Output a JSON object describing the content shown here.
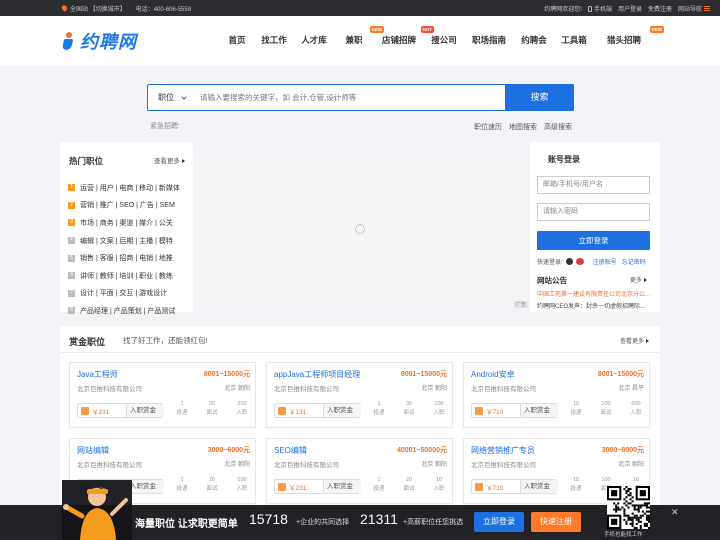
{
  "topbar": {
    "location": "全国站",
    "switch_city": "【切换城市】",
    "phone_label": "电话：400-606-5558",
    "welcome": "约聘网欢迎您!",
    "mobile": "手机端",
    "user_login": "用户登录",
    "free_register": "免费注册",
    "site_nav": "网站导航"
  },
  "logo": {
    "text": "约聘网"
  },
  "nav": [
    {
      "label": "首页",
      "badge": ""
    },
    {
      "label": "找工作",
      "badge": ""
    },
    {
      "label": "人才库",
      "badge": ""
    },
    {
      "label": "兼职",
      "badge": "NEW"
    },
    {
      "label": "店铺招牌",
      "badge": "HOT"
    },
    {
      "label": "搜公司",
      "badge": ""
    },
    {
      "label": "职场指南",
      "badge": ""
    },
    {
      "label": "约聘会",
      "badge": ""
    },
    {
      "label": "工具箱",
      "badge": ""
    },
    {
      "label": "猎头招聘",
      "badge": "NEW"
    }
  ],
  "search": {
    "type": "职位",
    "placeholder": "请输入要搜索的关键字，如 会计,仓管,设计师等",
    "button": "搜索"
  },
  "hot_search_label": "紧急招聘:",
  "search_links": [
    "职位速历",
    "地图搜索",
    "高级搜索"
  ],
  "hot_jobs": {
    "title": "热门职位",
    "more": "查看更多",
    "items": [
      "运营 | 用户 | 电商 | 移动 | 新媒体",
      "营销 | 推广 | SEO | 广告 | SEM",
      "市场 | 商务 | 渠道 | 媒介 | 公关",
      "编辑 | 文案 | 后期 | 主播 | 模特",
      "销售 | 客服 | 招商 | 电销 | 地推",
      "讲师 | 教师 | 培训 | 职业 | 教练",
      "设计 | 平面 | 交互 | 游戏设计",
      "产品经理 | 产品策划 | 产品测试"
    ],
    "num_colors": [
      "#f59b1d",
      "#f59b1d",
      "#f59b1d",
      "#bbbbbb",
      "#bbbbbb",
      "#bbbbbb",
      "#bbbbbb",
      "#bbbbbb"
    ]
  },
  "banner": {
    "ad_label": "广告"
  },
  "login": {
    "title": "账号登录",
    "user_placeholder": "邮箱/手机号/用户名",
    "pass_placeholder": "请输入密码",
    "button": "立即登录",
    "quick_label": "快速登录:",
    "register": "注册账号",
    "forgot": "忘记密码"
  },
  "announcement": {
    "title": "网站公告",
    "more": "更多",
    "items": [
      "中国工苑第一建设有限责任公司北京分公...",
      "约聘网CEO发声：封杀一切虚假招聘际..."
    ]
  },
  "reward": {
    "title": "赏金职位",
    "subtitle": "找了好工作，还能领红包!",
    "more": "查看更多",
    "cards": [
      {
        "title": "Java工程师",
        "salary": "8001~15000元",
        "company": "北京巨推科技有限公司",
        "location": "北京 朝阳",
        "amount": "￥231",
        "reward_label": "入职赏金",
        "stats": [
          {
            "n": "1",
            "l": "投递"
          },
          {
            "n": "20",
            "l": "面试"
          },
          {
            "n": "200",
            "l": "入职"
          }
        ]
      },
      {
        "title": "appJava工程师项目经理",
        "salary": "8001~15000元",
        "company": "北京巨推科技有限公司",
        "location": "北京 朝阳",
        "amount": "￥131",
        "reward_label": "入职赏金",
        "stats": [
          {
            "n": "1",
            "l": "投递"
          },
          {
            "n": "30",
            "l": "面试"
          },
          {
            "n": "100",
            "l": "入职"
          }
        ]
      },
      {
        "title": "Android安卓",
        "salary": "8001~15000元",
        "company": "北京巨推科技有限公司",
        "location": "北京 昌平",
        "amount": "￥710",
        "reward_label": "入职赏金",
        "stats": [
          {
            "n": "10",
            "l": "投递"
          },
          {
            "n": "100",
            "l": "面试"
          },
          {
            "n": "600",
            "l": "入职"
          }
        ]
      },
      {
        "title": "网站编辑",
        "salary": "3000~6000元",
        "company": "北京巨推科技有限公司",
        "location": "北京 朝阳",
        "amount": "",
        "reward_label": "入职赏金",
        "stats": [
          {
            "n": "1",
            "l": "投递"
          },
          {
            "n": "20",
            "l": "面试"
          },
          {
            "n": "100",
            "l": "入职"
          }
        ]
      },
      {
        "title": "SEO编辑",
        "salary": "40001~50000元",
        "company": "北京巨推科技有限公司",
        "location": "北京 朝阳",
        "amount": "￥231",
        "reward_label": "入职赏金",
        "stats": [
          {
            "n": "1",
            "l": "投递"
          },
          {
            "n": "20",
            "l": "面试"
          },
          {
            "n": "10",
            "l": "入职"
          }
        ]
      },
      {
        "title": "网络营销推广专员",
        "salary": "3000~8000元",
        "company": "北京巨推科技有限公司",
        "location": "北京 朝阳",
        "amount": "￥710",
        "reward_label": "入职赏金",
        "stats": [
          {
            "n": "10",
            "l": "投递"
          },
          {
            "n": "100",
            "l": "面试"
          },
          {
            "n": "10",
            "l": "入职"
          }
        ]
      }
    ]
  },
  "footer": {
    "slogan": "海量职位 让求职更简单",
    "num1": "15718",
    "desc1": "+企业的共同选择",
    "num2": "21311",
    "desc2": "+高薪职位任您挑选",
    "login_btn": "立即登录",
    "register_btn": "快速注册",
    "qr_caption": "手机也能找工作"
  },
  "colors": {
    "primary": "#1e6fe0",
    "accent": "#e9722e",
    "badge": "#ff7a29"
  }
}
